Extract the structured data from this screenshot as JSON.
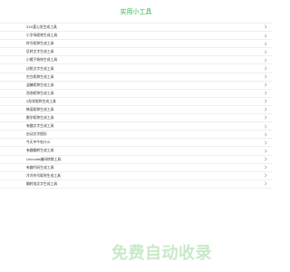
{
  "header": {
    "title": "实用小工具"
  },
  "tools": [
    "520爱心发生成工具",
    "小字母昵称生成工具",
    "符号昵称生成工具",
    "反转文字生成工具",
    "小帽子装饰生成工具",
    "边框文字生成工具",
    "空白昵称生成工具",
    "温馨昵称生成工具",
    "泡泡昵称生成工具",
    "0形状昵称生成工具",
    "韩语昵称生成工具",
    "数学昵称生成工具",
    "有趣文字生成工具",
    "启动文字图形",
    "今天中午吃什么",
    "有趣翻转生成工具",
    "Unicode编码转换工具",
    "有趣代码生成工具",
    "冷冷符号昵称生成工具",
    "翻转成文字生成工具"
  ],
  "banner": "免费自动收录"
}
